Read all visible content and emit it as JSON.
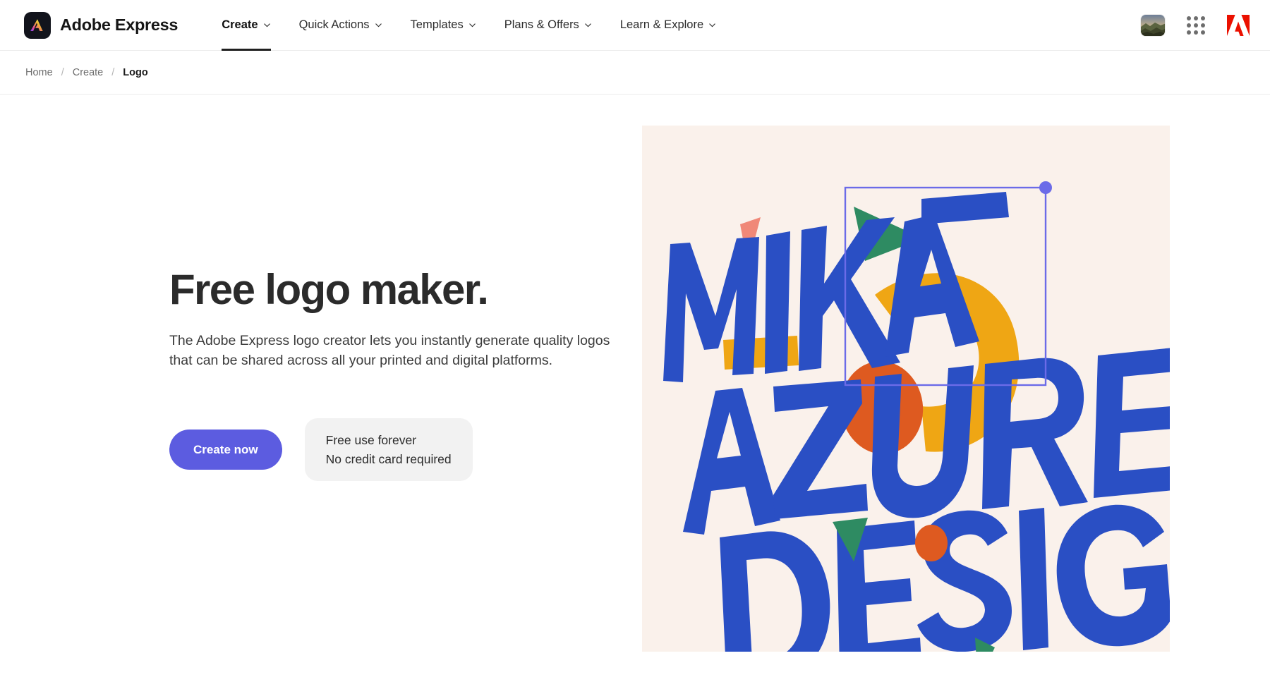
{
  "header": {
    "brand_name": "Adobe Express",
    "brand_icon": "adobe-express-logo-icon",
    "nav_items": [
      {
        "label": "Create",
        "has_chevron": true,
        "active": true
      },
      {
        "label": "Quick Actions",
        "has_chevron": true,
        "active": false
      },
      {
        "label": "Templates",
        "has_chevron": true,
        "active": false
      },
      {
        "label": "Plans & Offers",
        "has_chevron": true,
        "active": false
      },
      {
        "label": "Learn & Explore",
        "has_chevron": true,
        "active": false
      }
    ],
    "right_icons": [
      {
        "name": "user-avatar",
        "type": "photo-thumbnail"
      },
      {
        "name": "app-switcher-grid-icon",
        "type": "3x3-dots"
      },
      {
        "name": "adobe-logo-icon",
        "type": "adobe-a",
        "color": "#EB1000"
      }
    ]
  },
  "breadcrumb": {
    "items": [
      {
        "label": "Home",
        "current": false
      },
      {
        "label": "Create",
        "current": false
      },
      {
        "label": "Logo",
        "current": true
      }
    ],
    "separator": "/"
  },
  "main": {
    "headline": "Free logo maker.",
    "subcopy": "The Adobe Express logo creator lets you instantly generate quality logos that can be shared across all your printed and digital platforms.",
    "cta_label": "Create now",
    "cta_color": "#5C5CE0",
    "pill_line1": "Free use forever",
    "pill_line2": "No credit card required"
  },
  "hero": {
    "name": "logo-preview-canvas",
    "background_color": "#FAF1EB",
    "logo_text_lines": [
      "MIKA",
      "AZURE",
      "DESIGN"
    ],
    "palette": {
      "blue": "#2A4FC4",
      "yellow": "#EFA614",
      "orange": "#DE5A20",
      "green": "#2E8B62",
      "pink": "#F08878",
      "selection": "#6B6BE8"
    },
    "selection": {
      "visible": true,
      "handle": "top-right-resize-handle"
    }
  }
}
